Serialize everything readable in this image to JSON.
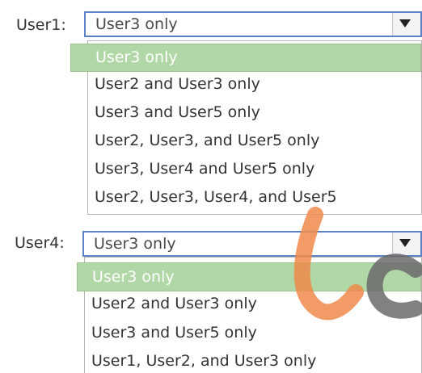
{
  "combos": [
    {
      "label": "User1:",
      "selected": "User3 only",
      "options": [
        "User3 only",
        "User2 and User3 only",
        "User3 and User5 only",
        "User2, User3, and User5 only",
        "User3, User4 and User5 only",
        "User2, User3, User4, and User5"
      ],
      "highlighted_index": 0
    },
    {
      "label": "User4:",
      "selected": "User3 only",
      "options": [
        "User3 only",
        "User2 and User3 only",
        "User3 and User5 only",
        "User1, User2, and User3 only"
      ],
      "highlighted_index": 0
    }
  ],
  "icons": {
    "dropdown": "triangle-down-icon",
    "watermark": "logo-watermark"
  },
  "colors": {
    "highlight": "#b1d7a6",
    "border_focus": "#5d83c4",
    "watermark_orange": "#f08a4b",
    "watermark_gray": "#6b6b6b"
  }
}
